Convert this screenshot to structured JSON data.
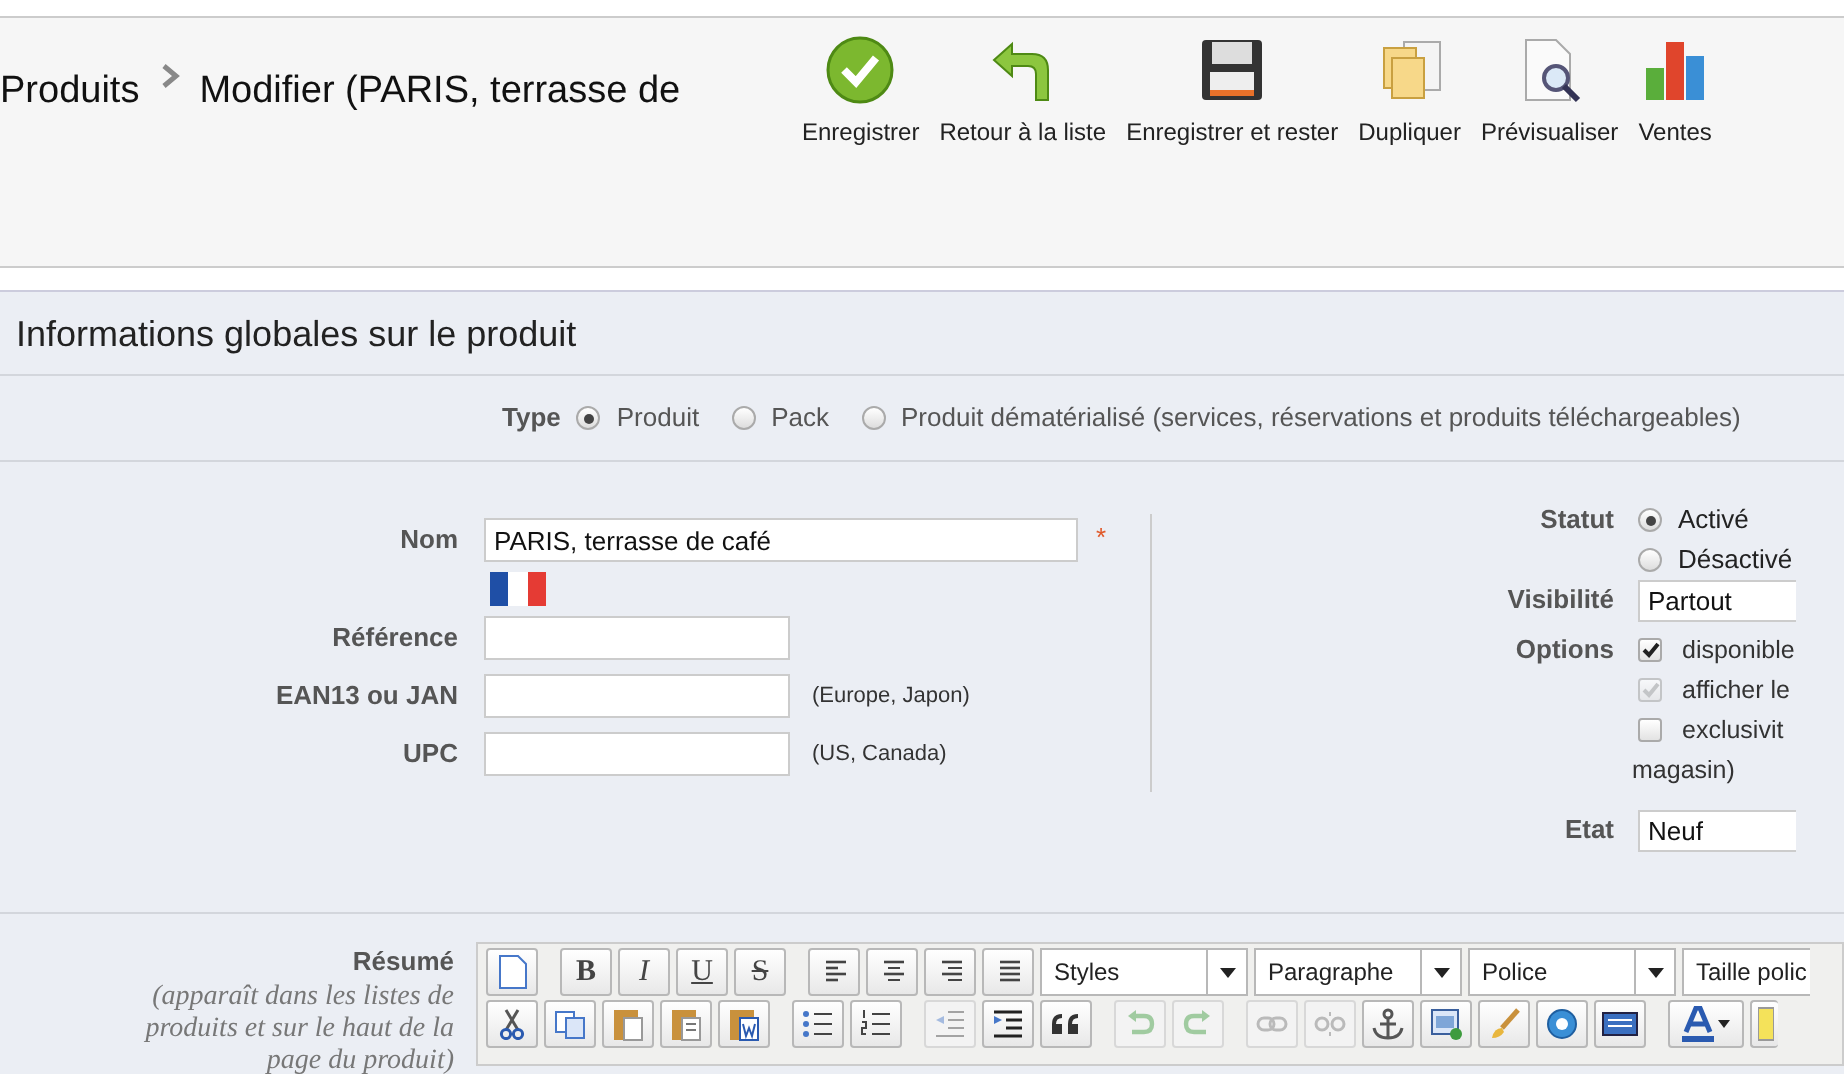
{
  "header": {
    "breadcrumb": [
      {
        "label": "Produits"
      },
      {
        "label": "Modifier (PARIS, terrasse de"
      }
    ],
    "toolbar": [
      {
        "kind": "check",
        "label": "Enregistrer"
      },
      {
        "kind": "back",
        "label": "Retour à la liste"
      },
      {
        "kind": "floppy",
        "label": "Enregistrer et rester"
      },
      {
        "kind": "pages",
        "label": "Dupliquer"
      },
      {
        "kind": "preview",
        "label": "Prévisualiser"
      },
      {
        "kind": "bars",
        "label": "Ventes"
      }
    ]
  },
  "panel": {
    "title": "Informations globales sur le produit",
    "type": {
      "label": "Type",
      "options": [
        {
          "label": "Produit",
          "selected": true
        },
        {
          "label": "Pack",
          "selected": false
        },
        {
          "label": "Produit dématérialisé (services, réservations et produits téléchargeables)",
          "selected": false
        }
      ]
    },
    "fields": [
      {
        "label": "Nom",
        "value": "PARIS, terrasse de café",
        "wide": true,
        "required_mark": "*",
        "flag": true
      },
      {
        "label": "Référence",
        "wide": false,
        "flag": false
      },
      {
        "label": "EAN13 ou JAN",
        "wide": false,
        "hint": "(Europe, Japon)",
        "flag": false
      },
      {
        "label": "UPC",
        "wide": false,
        "hint": "(US, Canada)",
        "flag": false
      }
    ],
    "status": {
      "label": "Statut",
      "options": [
        {
          "label": "Activé",
          "selected": true
        },
        {
          "label": "Désactivé",
          "selected": false
        }
      ]
    },
    "visibility": {
      "label": "Visibilité",
      "value": "Partout"
    },
    "options": {
      "label": "Options",
      "items": [
        {
          "label": "disponible",
          "checked": true,
          "disabled": false
        },
        {
          "label": "afficher le",
          "checked": true,
          "disabled": true
        },
        {
          "label": "exclusivit",
          "continued": "magasin)",
          "checked": false,
          "disabled": false
        }
      ]
    },
    "condition": {
      "label": "Etat",
      "value": "Neuf"
    },
    "summary": {
      "label": "Résumé",
      "hint": "(apparaît dans les listes de produits et sur le haut de la page du produit)",
      "editor": {
        "rows": [
          [
            {
              "kind": "newdoc",
              "disabled": false
            },
            {
              "kind": "sep"
            },
            {
              "kind": "bold",
              "text": "B",
              "disabled": false
            },
            {
              "kind": "italic",
              "text": "I",
              "disabled": false
            },
            {
              "kind": "underline",
              "text": "U",
              "disabled": false
            },
            {
              "kind": "strike",
              "text": "S",
              "disabled": false
            },
            {
              "kind": "sep"
            },
            {
              "kind": "alignleft",
              "disabled": false
            },
            {
              "kind": "aligncenter",
              "disabled": false
            },
            {
              "kind": "alignright",
              "disabled": false
            },
            {
              "kind": "justify",
              "disabled": false
            },
            {
              "kind": "dropdown",
              "text": "Styles",
              "cut": false
            },
            {
              "kind": "dropdown",
              "text": "Paragraphe",
              "cut": false
            },
            {
              "kind": "dropdown",
              "text": "Police",
              "cut": false
            },
            {
              "kind": "dropdown",
              "text": "Taille polic",
              "cut": true
            }
          ],
          [
            {
              "kind": "cut",
              "disabled": false
            },
            {
              "kind": "copy",
              "disabled": false
            },
            {
              "kind": "paste",
              "disabled": false
            },
            {
              "kind": "pastetext",
              "disabled": false
            },
            {
              "kind": "pasteword",
              "disabled": false
            },
            {
              "kind": "sep"
            },
            {
              "kind": "bullets",
              "disabled": false
            },
            {
              "kind": "numbers",
              "disabled": false
            },
            {
              "kind": "sep"
            },
            {
              "kind": "outdent",
              "disabled": true
            },
            {
              "kind": "indent",
              "disabled": false
            },
            {
              "kind": "quote",
              "disabled": false
            },
            {
              "kind": "sep"
            },
            {
              "kind": "undo",
              "disabled": true
            },
            {
              "kind": "redo",
              "disabled": true
            },
            {
              "kind": "sep"
            },
            {
              "kind": "link",
              "disabled": true
            },
            {
              "kind": "unlink",
              "disabled": true
            },
            {
              "kind": "anchor",
              "disabled": false
            },
            {
              "kind": "image",
              "disabled": false
            },
            {
              "kind": "brush",
              "disabled": false
            },
            {
              "kind": "help",
              "disabled": false
            },
            {
              "kind": "html",
              "disabled": false
            },
            {
              "kind": "sep"
            },
            {
              "kind": "fontcolor",
              "disabled": false
            },
            {
              "kind": "highlight",
              "disabled": false
            }
          ]
        ]
      }
    }
  }
}
